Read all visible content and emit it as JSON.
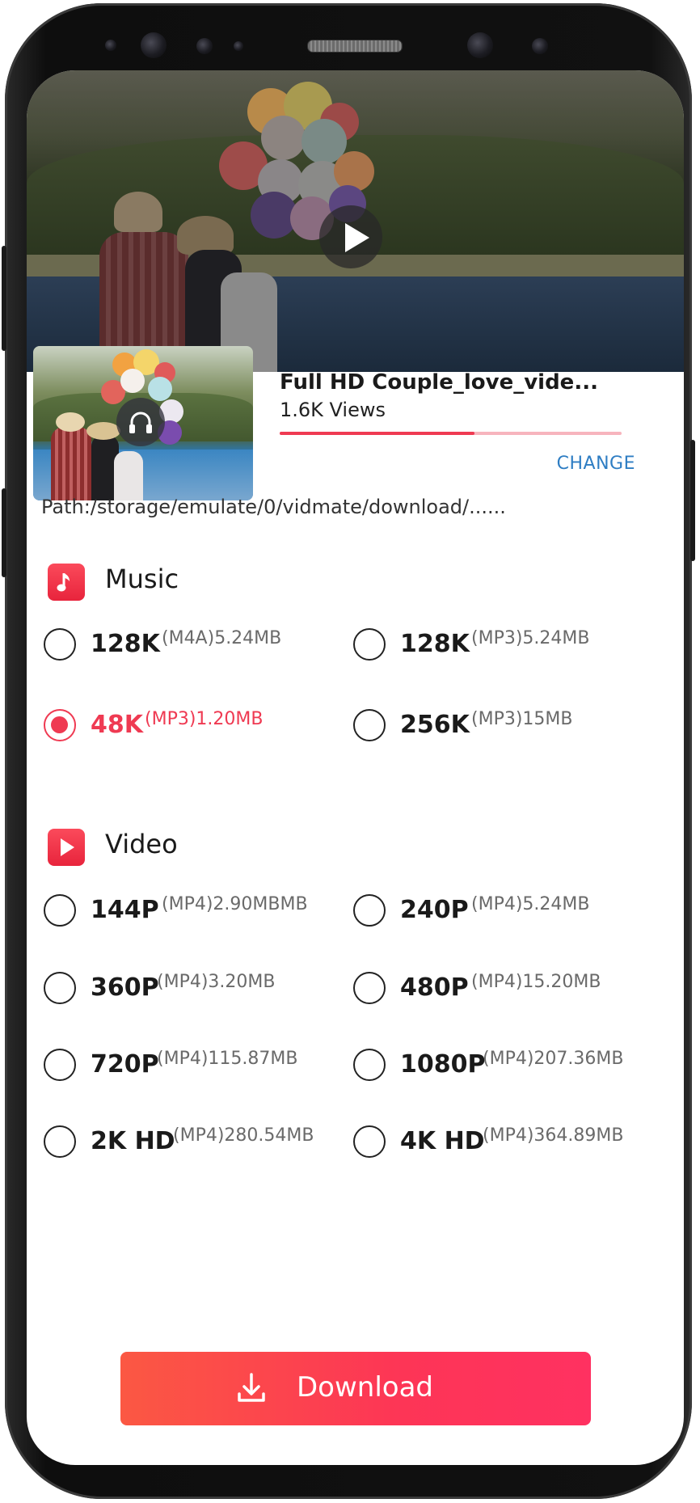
{
  "video": {
    "title": "Full HD Couple_love_vide...",
    "views": "1.6K Views",
    "progress_fraction": 0.57,
    "change_label": "CHANGE",
    "path": "Path:/storage/emulate/0/vidmate/download/......"
  },
  "music": {
    "title": "Music",
    "icon": "music-note-icon",
    "options": [
      {
        "quality": "128K",
        "detail": "(M4A)5.24MB",
        "selected": false
      },
      {
        "quality": "128K",
        "detail": "(MP3)5.24MB",
        "selected": false
      },
      {
        "quality": "48K",
        "detail": "(MP3)1.20MB",
        "selected": true
      },
      {
        "quality": "256K",
        "detail": "(MP3)15MB",
        "selected": false
      }
    ]
  },
  "video_section": {
    "title": "Video",
    "icon": "play-icon",
    "options": [
      {
        "quality": "144P",
        "detail": "(MP4)2.90MBMB",
        "selected": false
      },
      {
        "quality": "240P",
        "detail": "(MP4)5.24MB",
        "selected": false
      },
      {
        "quality": "360P",
        "detail": "(MP4)3.20MB",
        "selected": false
      },
      {
        "quality": "480P",
        "detail": "(MP4)15.20MB",
        "selected": false
      },
      {
        "quality": "720P",
        "detail": "(MP4)115.87MB",
        "selected": false
      },
      {
        "quality": "1080P",
        "detail": "(MP4)207.36MB",
        "selected": false
      },
      {
        "quality": "2K HD",
        "detail": "(MP4)280.54MB",
        "selected": false
      },
      {
        "quality": "4K HD",
        "detail": "(MP4)364.89MB",
        "selected": false
      }
    ]
  },
  "download": {
    "label": "Download",
    "icon": "download-icon"
  },
  "colors": {
    "accent": "#ef3a52",
    "link": "#2e7dc3",
    "progress_track": "#f7b4bd"
  }
}
